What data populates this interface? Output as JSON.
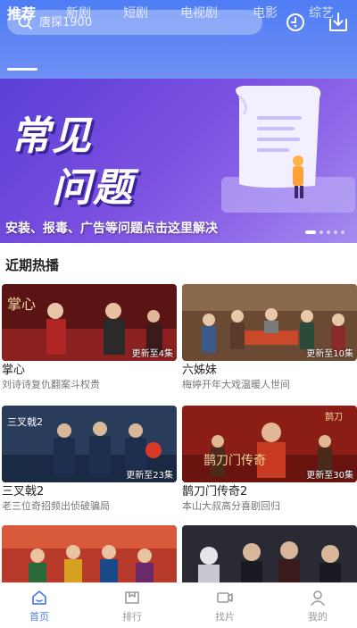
{
  "search": {
    "placeholder": "唐探1900"
  },
  "header_icons": [
    "history-icon",
    "download-icon"
  ],
  "tabs": [
    {
      "label": "推荐",
      "active": true
    },
    {
      "label": "新剧"
    },
    {
      "label": "短剧"
    },
    {
      "label": "电视剧"
    },
    {
      "label": "电影"
    },
    {
      "label": "综艺"
    }
  ],
  "banner": {
    "title_line1": "常见",
    "title_line2": "问题",
    "subtitle": "安装、报毒、广告等问题点击这里解决",
    "dots": 5,
    "active_dot": 0
  },
  "section": {
    "title": "近期热播"
  },
  "cards": [
    {
      "title": "掌心",
      "desc": "刘诗诗复仇翻案斗权贵",
      "badge": "更新至4集",
      "thumb_color": "#7a1f1f"
    },
    {
      "title": "六姊妹",
      "desc": "梅婷开年大戏温暖人世间",
      "badge": "更新至10集",
      "thumb_color": "#8a5a3a"
    },
    {
      "title": "三叉戟2",
      "desc": "老三位奇招频出侦破骗局",
      "badge": "更新至23集",
      "thumb_color": "#2b4a7a"
    },
    {
      "title": "鹊刀门传奇2",
      "desc": "本山大叔高分喜剧回归",
      "badge": "更新至30集",
      "thumb_color": "#a02a1e"
    },
    {
      "title": "",
      "desc": "",
      "badge": "",
      "thumb_color": "#b53a2a"
    },
    {
      "title": "",
      "desc": "",
      "badge": "",
      "thumb_color": "#2a2a3a"
    }
  ],
  "bottom_nav": [
    {
      "label": "首页",
      "icon": "home-icon",
      "active": true
    },
    {
      "label": "排行",
      "icon": "ranking-icon"
    },
    {
      "label": "找片",
      "icon": "video-search-icon"
    },
    {
      "label": "我的",
      "icon": "profile-icon"
    }
  ],
  "colors": {
    "accent": "#4f7df5",
    "banner": "#6b4ddc"
  }
}
